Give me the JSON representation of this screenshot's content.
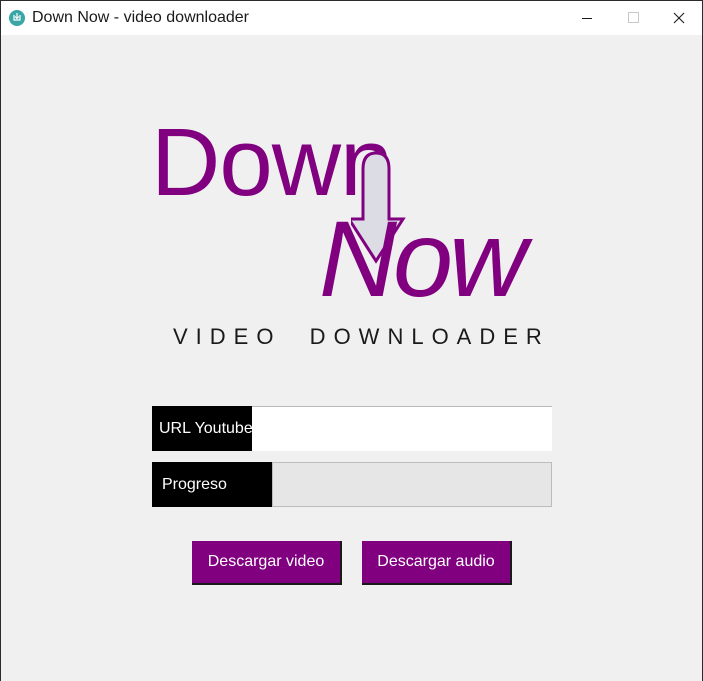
{
  "window": {
    "title": "Down Now - video downloader",
    "app_icon": "download-icon"
  },
  "logo": {
    "word1": "Down",
    "word2": "Now",
    "subtitle": "VIDEO  DOWNLOADER",
    "color": "#800080",
    "arrow_icon": "down-arrow-icon"
  },
  "form": {
    "url_label": "URL Youtube",
    "url_value": "",
    "url_placeholder": "",
    "progress_label": "Progreso",
    "progress_value": 0
  },
  "actions": {
    "download_video_label": "Descargar video",
    "download_audio_label": "Descargar audio",
    "button_color": "#800080"
  }
}
